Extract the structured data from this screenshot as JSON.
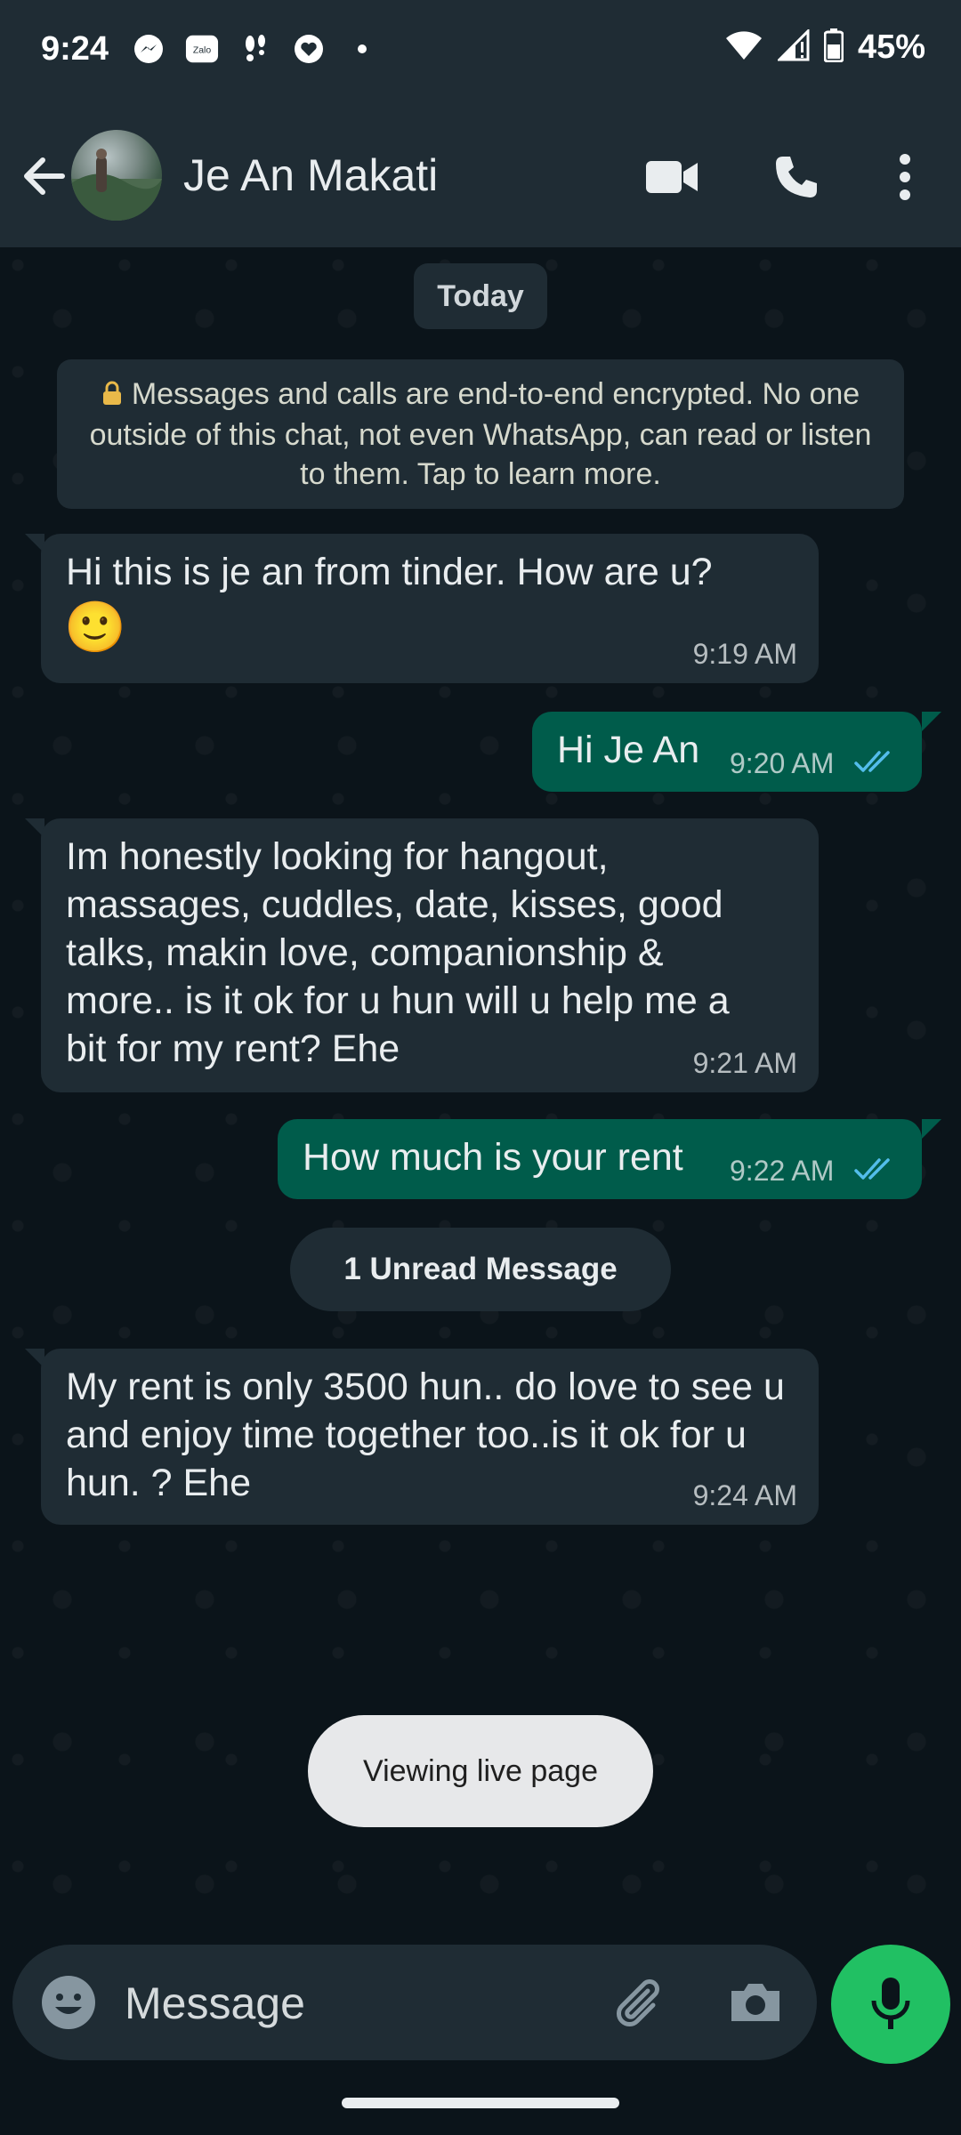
{
  "status_bar": {
    "time": "9:24",
    "battery": "45%",
    "notification_icons": [
      "messenger-icon",
      "zalo-icon",
      "footsteps-icon",
      "heart-app-icon",
      "dot-icon"
    ],
    "zalo_label": "Zalo"
  },
  "header": {
    "contact_name": "Je An Makati"
  },
  "chat": {
    "date_chip": "Today",
    "encryption_notice": "Messages and calls are end-to-end encrypted. No one outside of this chat, not even WhatsApp, can read or listen to them. Tap to learn more.",
    "messages": [
      {
        "direction": "incoming",
        "text": "Hi this is je an from tinder. How are u?",
        "emoji": "🙂",
        "time": "9:19 AM"
      },
      {
        "direction": "outgoing",
        "text": "Hi Je An",
        "time": "9:20 AM",
        "status": "read"
      },
      {
        "direction": "incoming",
        "text": "Im honestly looking for hangout, massages, cuddles, date, kisses, good talks, makin love, companionship & more.. is it ok for u hun will u help me a bit for my rent? Ehe",
        "time": "9:21 AM"
      },
      {
        "direction": "outgoing",
        "text": "How much is your rent",
        "time": "9:22 AM",
        "status": "read"
      },
      {
        "direction": "incoming",
        "text": "My rent is only 3500 hun.. do love to see u and enjoy time together too..is it ok for u hun. ? Ehe",
        "time": "9:24 AM"
      }
    ],
    "unread_label": "1 Unread Message"
  },
  "toast": "Viewing live page",
  "composer": {
    "placeholder": "Message"
  },
  "colors": {
    "header_bg": "#1f2c34",
    "chat_bg": "#0b141a",
    "incoming_bubble": "#1f2c34",
    "outgoing_bubble": "#005c4b",
    "read_ticks": "#53bdeb",
    "mic_button": "#21c063"
  }
}
